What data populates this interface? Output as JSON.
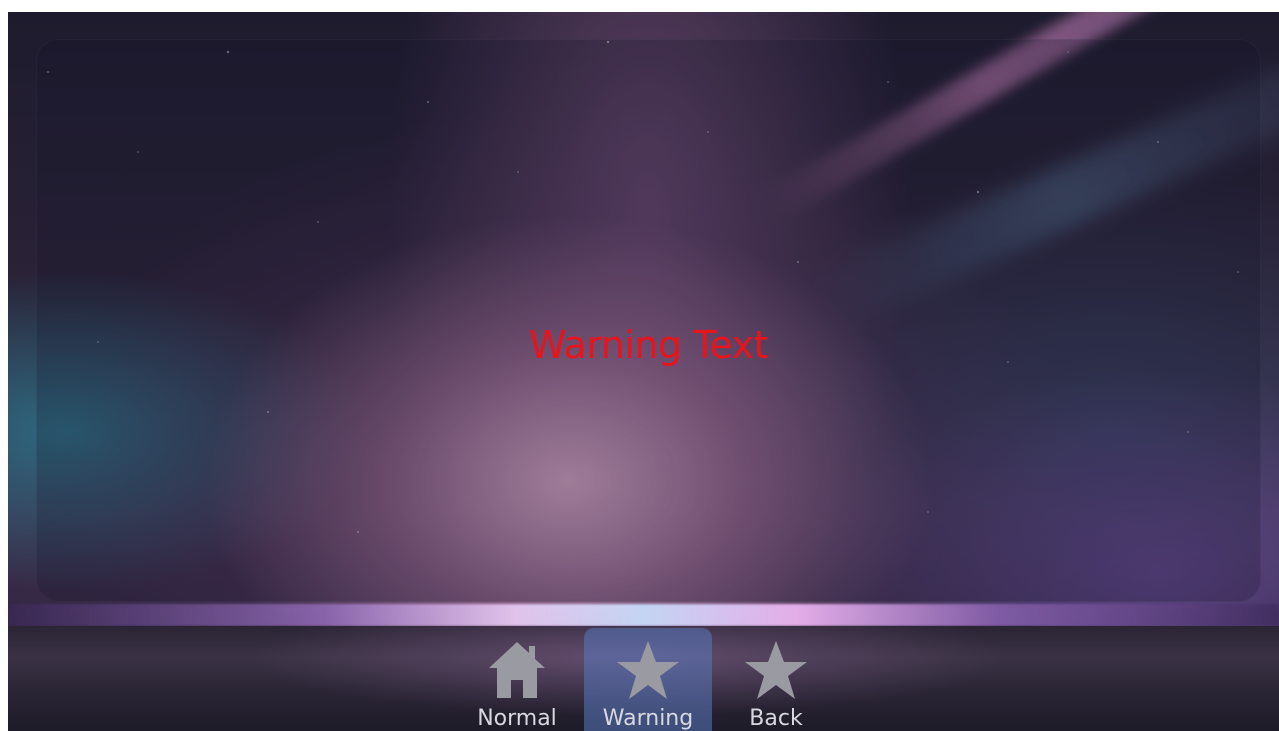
{
  "main": {
    "message": "Warning Text",
    "message_color": "#e8141c"
  },
  "nav": {
    "items": [
      {
        "label": "Normal",
        "icon": "home-icon",
        "active": false
      },
      {
        "label": "Warning",
        "icon": "star-icon",
        "active": true
      },
      {
        "label": "Back",
        "icon": "star-icon",
        "active": false
      }
    ]
  },
  "colors": {
    "icon": "#9a9aa2",
    "nav_active_bg": "#5a78be"
  }
}
